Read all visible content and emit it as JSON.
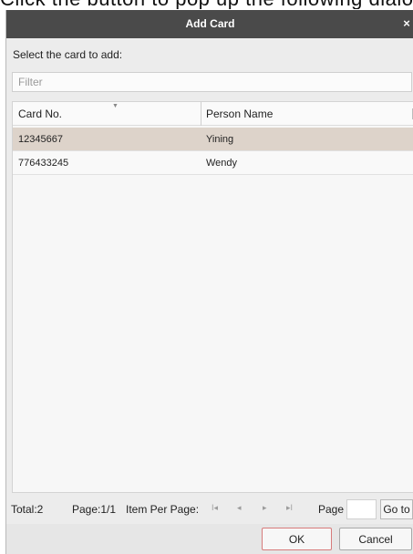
{
  "background_fragment": "Click the button to pop up the following dialog",
  "dialog": {
    "title": "Add Card",
    "close_glyph": "×"
  },
  "prompt": "Select the card to add:",
  "filter": {
    "placeholder": "Filter",
    "value": ""
  },
  "table": {
    "columns": [
      "Card No.",
      "Person Name"
    ],
    "sort_indicator": "▼",
    "rows": [
      {
        "card_no": "12345667",
        "person_name": "Yining",
        "selected": true
      },
      {
        "card_no": "776433245",
        "person_name": "Wendy",
        "selected": false
      }
    ]
  },
  "pager": {
    "total": "Total:2",
    "page_info": "Page:1/1",
    "items_per_page": "Item Per Page:",
    "first_glyph": "I◂",
    "prev_glyph": "◂",
    "next_glyph": "▸",
    "last_glyph": "▸I",
    "page_label": "Page",
    "page_input_value": "",
    "goto_label": "Go to"
  },
  "buttons": {
    "ok": "OK",
    "cancel": "Cancel"
  },
  "icons": {
    "close": "close-icon",
    "sort": "sort-arrow-icon",
    "first": "first-page-icon",
    "prev": "prev-page-icon",
    "next": "next-page-icon",
    "last": "last-page-icon"
  },
  "colors": {
    "titlebar": "#4a4a4a",
    "dialog_bg": "#ececec",
    "selected_row": "#ddd3ca",
    "ok_border": "#d77b7b"
  }
}
